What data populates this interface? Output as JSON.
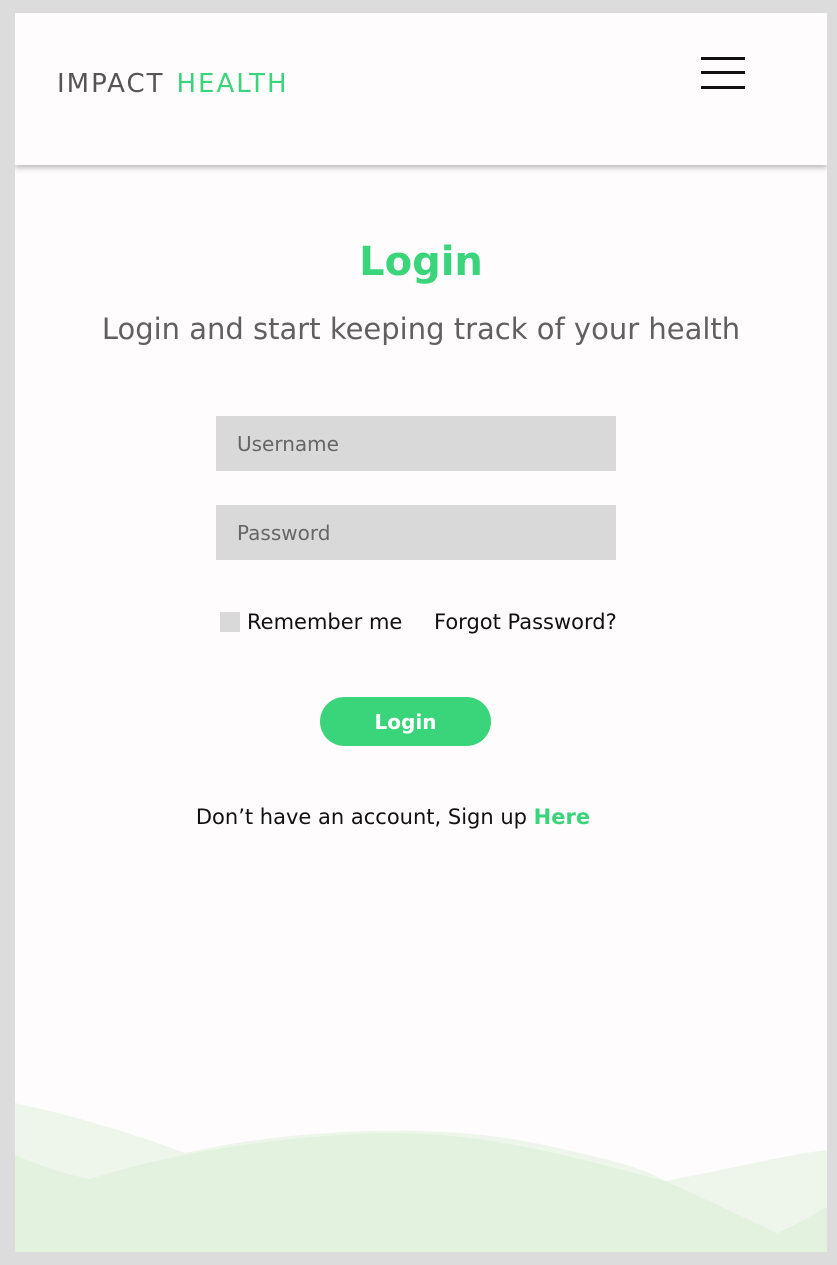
{
  "header": {
    "logo": {
      "word_1": "IMPACT",
      "word_2": "HEALTH"
    },
    "menu_icon": "hamburger-menu-icon"
  },
  "main": {
    "title": "Login",
    "subtitle": "Login and start keeping track of your health",
    "form": {
      "username": {
        "placeholder": "Username",
        "value": ""
      },
      "password": {
        "placeholder": "Password",
        "value": ""
      },
      "remember_label": "Remember me",
      "remember_checked": false,
      "forgot_label": "Forgot Password?",
      "submit_label": "Login"
    },
    "signup": {
      "prefix": "Don’t have an account, Sign up ",
      "link_label": "Here"
    }
  },
  "colors": {
    "accent": "#3ad47a",
    "background": "#fefcfd",
    "input_background": "#d9d9d9",
    "wave_light": "#eef6ec",
    "wave_dark": "#e3f2df"
  }
}
